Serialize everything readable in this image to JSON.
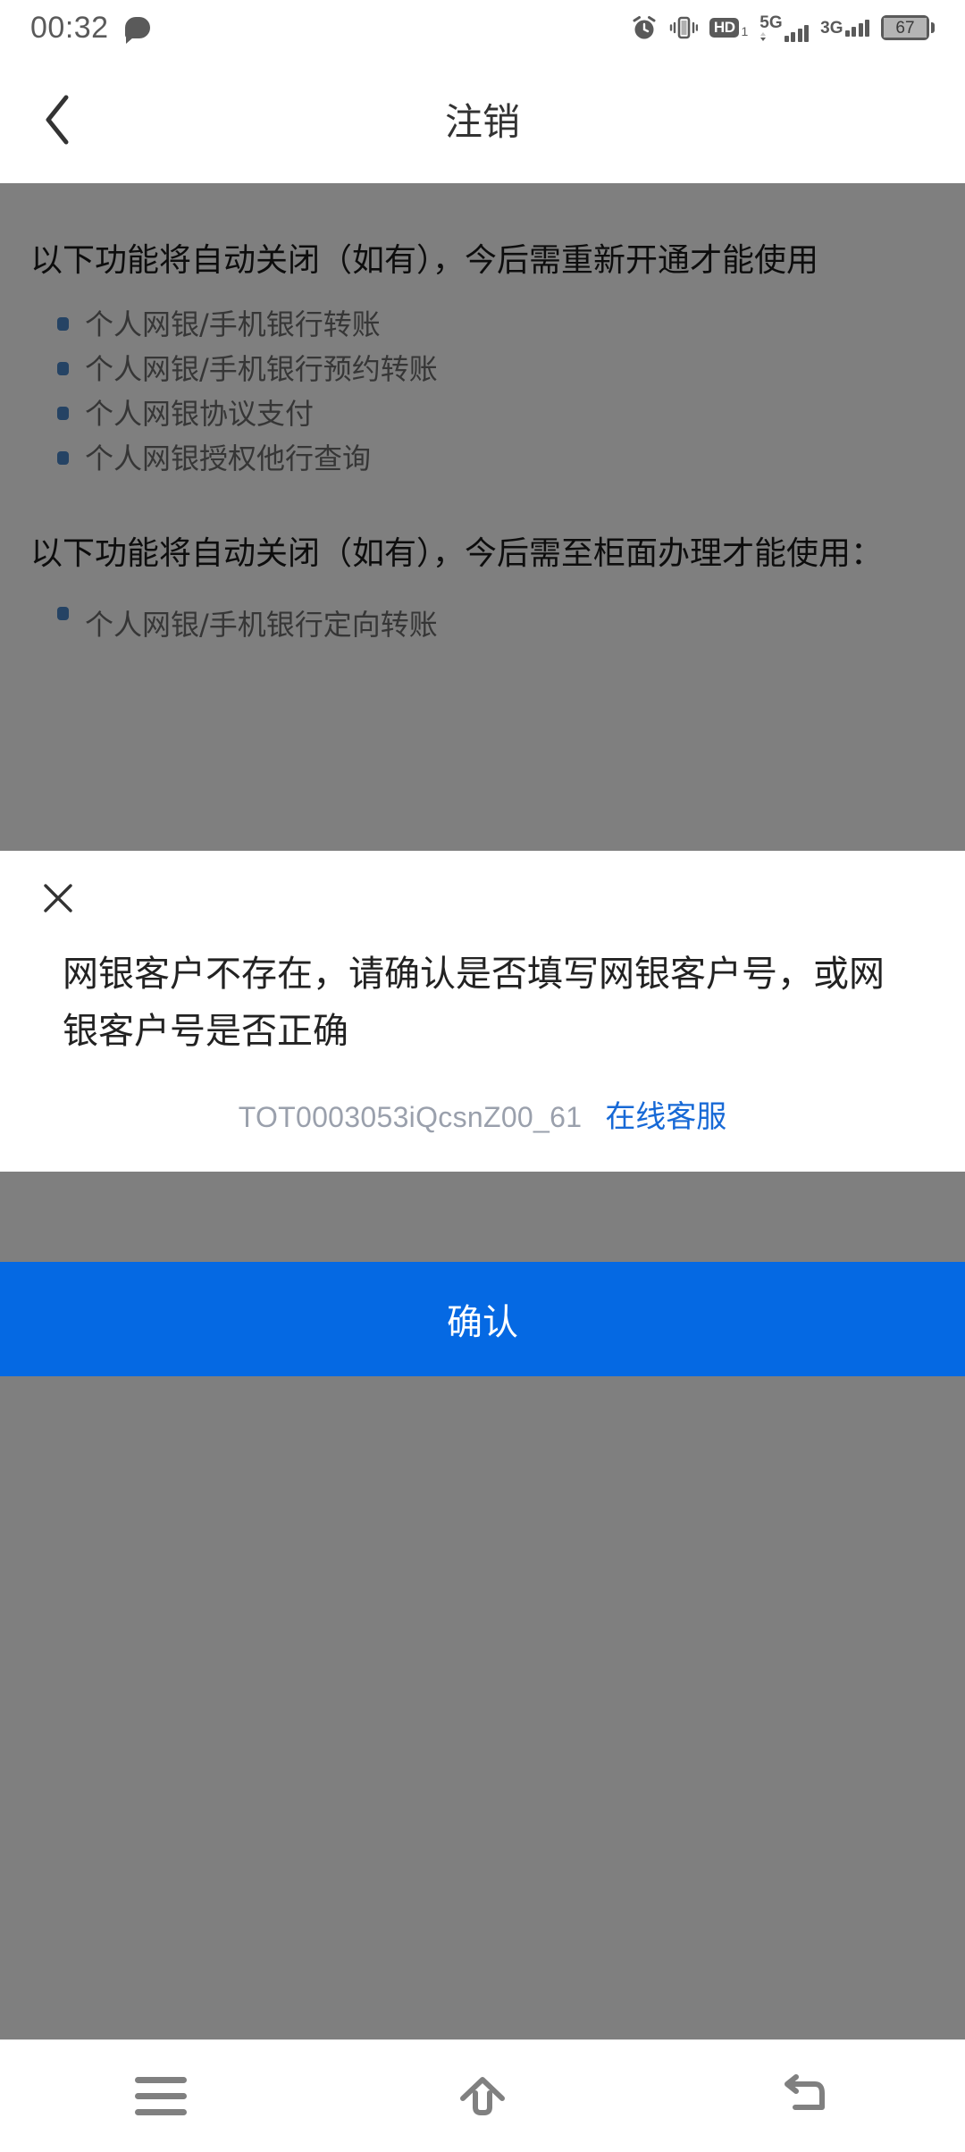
{
  "status_bar": {
    "time": "00:32",
    "icons": [
      {
        "name": "chat-bubble-icon"
      },
      {
        "name": "alarm-clock-icon"
      },
      {
        "name": "vibrate-icon"
      },
      {
        "name": "hd-volte-icon",
        "label": "HD",
        "sub": "1"
      },
      {
        "name": "signal-5g-icon",
        "label": "5G"
      },
      {
        "name": "signal-3g-icon",
        "label": "3G"
      },
      {
        "name": "battery-icon",
        "level": "67"
      }
    ]
  },
  "app_bar": {
    "back_icon": "chevron-left-icon",
    "title": "注销"
  },
  "content": {
    "section_1": {
      "paragraph": "以下功能将自动关闭（如有），今后需重新开通才能使用",
      "items": [
        "个人网银/手机银行转账",
        "个人网银/手机银行预约转账",
        "个人网银协议支付",
        "个人网银授权他行查询"
      ]
    },
    "section_2": {
      "paragraph": "以下功能将自动关闭（如有），今后需至柜面办理才能使用：",
      "items": [
        "个人网银/手机银行定向转账"
      ]
    }
  },
  "dialog": {
    "close_icon": "close-x-icon",
    "message": "网银客户不存在，请确认是否填写网银客户号，或网银客户号是否正确",
    "error_code": "TOT0003053iQcsnZ00_61",
    "service_link": "在线客服"
  },
  "confirm_button": {
    "label": "确认",
    "color": "#0569E3"
  },
  "nav_bar": {
    "recents_icon": "menu-recents-icon",
    "home_icon": "home-icon",
    "back_icon": "back-arrow-icon"
  },
  "colors": {
    "accent_blue": "#0569E3",
    "link_blue": "#1769d6",
    "bullet_blue": "#4a86c8",
    "overlay": "rgba(0,0,0,0.5)"
  }
}
